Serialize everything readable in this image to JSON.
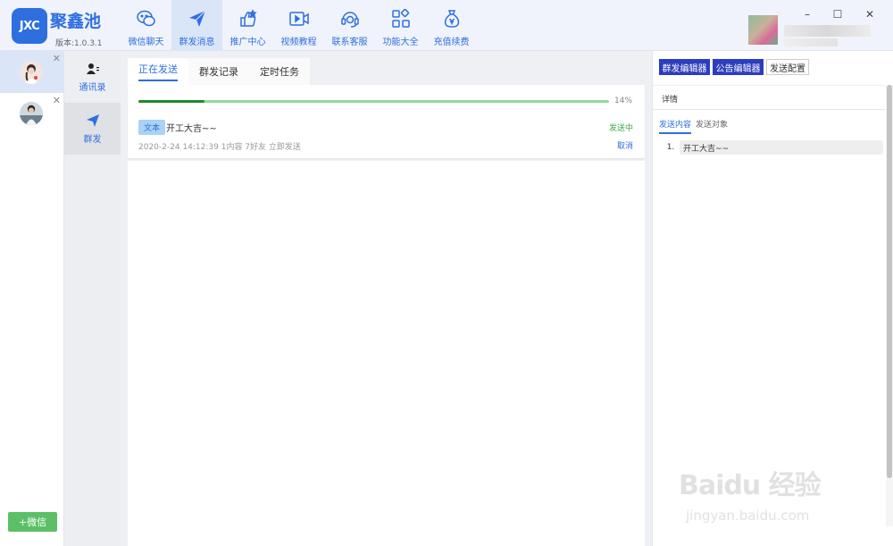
{
  "app": {
    "logo_text": "JXC",
    "name": "聚鑫池",
    "version": "版本:1.0.3.1"
  },
  "nav": [
    {
      "label": "微信聊天",
      "icon": "chat-icon"
    },
    {
      "label": "群发消息",
      "icon": "send-icon",
      "active": true
    },
    {
      "label": "推广中心",
      "icon": "promotion-icon"
    },
    {
      "label": "视频教程",
      "icon": "video-icon"
    },
    {
      "label": "联系客服",
      "icon": "support-icon"
    },
    {
      "label": "功能大全",
      "icon": "apps-icon"
    },
    {
      "label": "充值续费",
      "icon": "money-bag-icon"
    }
  ],
  "window": {
    "minimize": "–",
    "maximize": "☐",
    "close": "✕"
  },
  "accounts": {
    "close_symbol": "✕",
    "add_label": "+微信"
  },
  "subnav": [
    {
      "label": "通讯录",
      "icon": "contacts-icon"
    },
    {
      "label": "群发",
      "icon": "send-icon",
      "active": true
    }
  ],
  "main": {
    "tabs": [
      {
        "label": "正在发送",
        "active": true
      },
      {
        "label": "群发记录"
      },
      {
        "label": "定时任务"
      }
    ],
    "task": {
      "progress": 0.14,
      "progress_text": "14%",
      "type": "文本",
      "message": "开工大吉~~",
      "status": "发送中",
      "meta": "2020-2-24 14:12:39 1内容 7好友 立即发送",
      "cancel": "取消"
    }
  },
  "right": {
    "buttons": {
      "mass_editor": "群发编辑器",
      "notice_editor": "公告编辑器",
      "send_config": "发送配置"
    },
    "detail_title": "详情",
    "subtabs": [
      {
        "label": "发送内容",
        "active": true
      },
      {
        "label": "发送对象"
      }
    ],
    "items": [
      {
        "index": "1.",
        "text": "开工大吉~~"
      }
    ]
  },
  "watermark": {
    "logo": "Baidu 经验",
    "url": "jingyan.baidu.com"
  },
  "colors": {
    "accent": "#2e6fe0",
    "primary_button": "#2c3dbf",
    "success": "#3ba845",
    "add_button": "#5cbf67"
  }
}
